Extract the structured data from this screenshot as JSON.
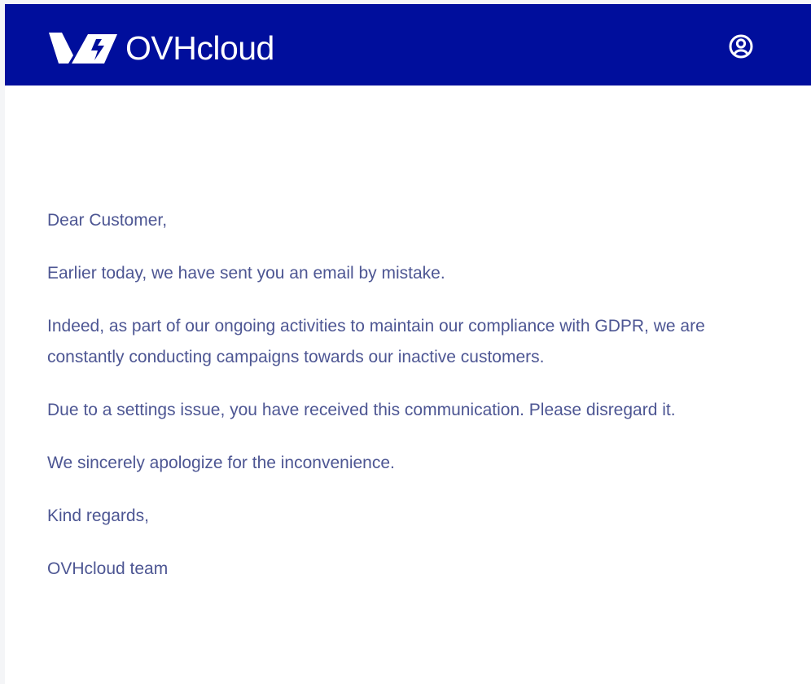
{
  "header": {
    "brand_name": "OVHcloud",
    "background_color": "#000e9c",
    "logo_icon": "ovhcloud-logo-icon",
    "account_icon": "user-account-icon"
  },
  "email": {
    "text_color": "#4d5693",
    "greeting": "Dear Customer,",
    "paragraphs": [
      "Earlier today, we have sent you an email by mistake.",
      "Indeed, as part of our ongoing activities to maintain our compliance with GDPR, we are constantly conducting campaigns towards our inactive customers.",
      "Due to a settings issue, you have received this communication. Please disregard it.",
      "We sincerely apologize for the inconvenience."
    ],
    "closing": "Kind regards,",
    "signature": "OVHcloud team"
  }
}
